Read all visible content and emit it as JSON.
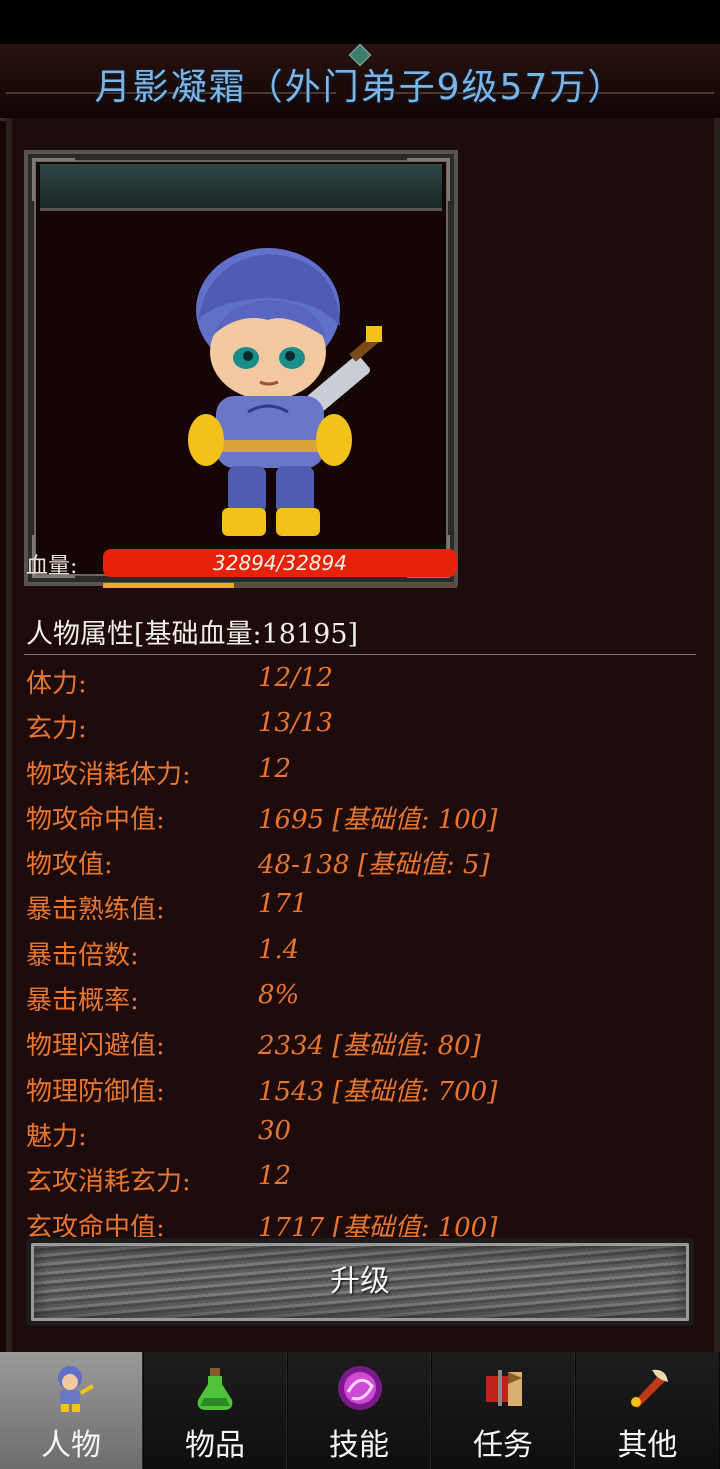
{
  "header": {
    "title": "月影凝霜（外门弟子9级57万）"
  },
  "portrait": {
    "hp_label": "血量:",
    "hp_text": "32894/32894",
    "hp_fraction": 1.0,
    "sub_bar_fraction": 0.37
  },
  "attributes": {
    "header": "人物属性[基础血量:18195]",
    "rows": [
      {
        "label": "体力:",
        "value": "12/12"
      },
      {
        "label": "玄力:",
        "value": "13/13"
      },
      {
        "label": "物攻消耗体力:",
        "value": "12"
      },
      {
        "label": "物攻命中值:",
        "value": "1695 [基础值: 100]"
      },
      {
        "label": "物攻值:",
        "value": "48-138 [基础值: 5]"
      },
      {
        "label": "暴击熟练值:",
        "value": "171"
      },
      {
        "label": "暴击倍数:",
        "value": "1.4"
      },
      {
        "label": "暴击概率:",
        "value": "8%"
      },
      {
        "label": "物理闪避值:",
        "value": "2334 [基础值: 80]"
      },
      {
        "label": "物理防御值:",
        "value": "1543 [基础值: 700]"
      },
      {
        "label": "魅力:",
        "value": "30"
      },
      {
        "label": "玄攻消耗玄力:",
        "value": "12"
      },
      {
        "label": "玄攻命中值:",
        "value": "1717 [基础值: 100]"
      }
    ]
  },
  "upgrade_button": {
    "label": "升级"
  },
  "tabs": [
    {
      "label": "人物",
      "icon": "character-icon",
      "active": true
    },
    {
      "label": "物品",
      "icon": "potion-icon",
      "active": false
    },
    {
      "label": "技能",
      "icon": "skill-orb-icon",
      "active": false
    },
    {
      "label": "任务",
      "icon": "quest-flag-icon",
      "active": false
    },
    {
      "label": "其他",
      "icon": "weapon-icon",
      "active": false
    }
  ],
  "colors": {
    "title": "#7db4e4",
    "attr_text": "#e8762e",
    "hp_bar": "#e8220a",
    "sub_bar": "#f0a820"
  }
}
